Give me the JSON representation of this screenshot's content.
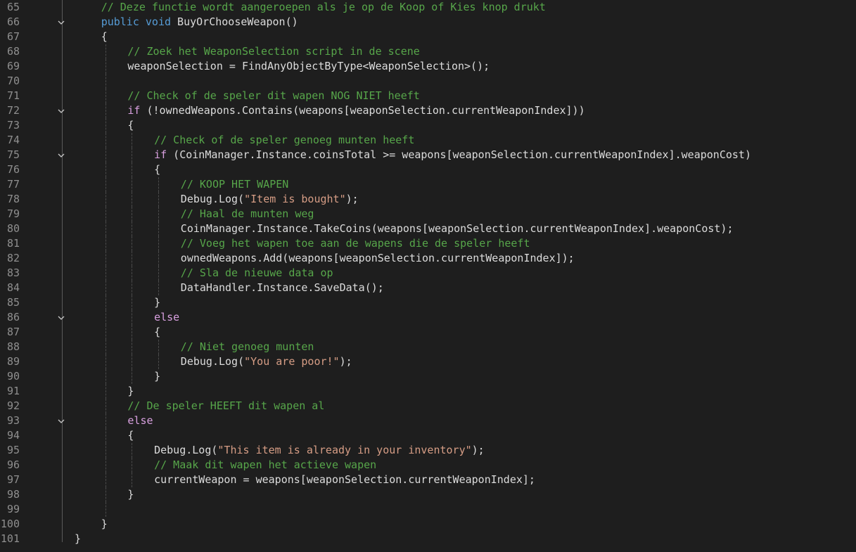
{
  "editor": {
    "colors": {
      "background": "#1e1e1e",
      "line_number": "#8f8f8f",
      "comment": "#57a64a",
      "keyword": "#569cd6",
      "control_keyword": "#d8a0df",
      "string": "#d69d85",
      "plain": "#dcdcdc"
    },
    "fold_icon": "chevron-down-icon",
    "lines": [
      {
        "num": "65",
        "fold": false,
        "indent": 1,
        "tokens": [
          {
            "t": "// Deze functie wordt aangeroepen als je op de Koop of Kies knop drukt",
            "c": "com"
          }
        ]
      },
      {
        "num": "66",
        "fold": true,
        "indent": 1,
        "tokens": [
          {
            "t": "public",
            "c": "kw"
          },
          {
            "t": " ",
            "c": "txt"
          },
          {
            "t": "void",
            "c": "kw"
          },
          {
            "t": " BuyOrChooseWeapon()",
            "c": "txt"
          }
        ]
      },
      {
        "num": "67",
        "fold": false,
        "indent": 1,
        "tokens": [
          {
            "t": "{",
            "c": "txt"
          }
        ]
      },
      {
        "num": "68",
        "fold": false,
        "indent": 2,
        "tokens": [
          {
            "t": "// Zoek het WeaponSelection script in de scene",
            "c": "com"
          }
        ]
      },
      {
        "num": "69",
        "fold": false,
        "indent": 2,
        "tokens": [
          {
            "t": "weaponSelection = FindAnyObjectByType<WeaponSelection>();",
            "c": "txt"
          }
        ]
      },
      {
        "num": "70",
        "fold": false,
        "indent": 2,
        "tokens": []
      },
      {
        "num": "71",
        "fold": false,
        "indent": 2,
        "tokens": [
          {
            "t": "// Check of de speler dit wapen NOG NIET heeft",
            "c": "com"
          }
        ]
      },
      {
        "num": "72",
        "fold": true,
        "indent": 2,
        "tokens": [
          {
            "t": "if",
            "c": "ctl"
          },
          {
            "t": " (!ownedWeapons.Contains(weapons[weaponSelection.currentWeaponIndex]))",
            "c": "txt"
          }
        ]
      },
      {
        "num": "73",
        "fold": false,
        "indent": 2,
        "tokens": [
          {
            "t": "{",
            "c": "txt"
          }
        ]
      },
      {
        "num": "74",
        "fold": false,
        "indent": 3,
        "tokens": [
          {
            "t": "// Check of de speler genoeg munten heeft",
            "c": "com"
          }
        ]
      },
      {
        "num": "75",
        "fold": true,
        "indent": 3,
        "tokens": [
          {
            "t": "if",
            "c": "ctl"
          },
          {
            "t": " (CoinManager.Instance.coinsTotal >= weapons[weaponSelection.currentWeaponIndex].weaponCost)",
            "c": "txt"
          }
        ]
      },
      {
        "num": "76",
        "fold": false,
        "indent": 3,
        "tokens": [
          {
            "t": "{",
            "c": "txt"
          }
        ]
      },
      {
        "num": "77",
        "fold": false,
        "indent": 4,
        "tokens": [
          {
            "t": "// KOOP HET WAPEN",
            "c": "com"
          }
        ]
      },
      {
        "num": "78",
        "fold": false,
        "indent": 4,
        "tokens": [
          {
            "t": "Debug.Log(",
            "c": "txt"
          },
          {
            "t": "\"Item is bought\"",
            "c": "str"
          },
          {
            "t": ");",
            "c": "txt"
          }
        ]
      },
      {
        "num": "79",
        "fold": false,
        "indent": 4,
        "tokens": [
          {
            "t": "// Haal de munten weg",
            "c": "com"
          }
        ]
      },
      {
        "num": "80",
        "fold": false,
        "indent": 4,
        "tokens": [
          {
            "t": "CoinManager.Instance.TakeCoins(weapons[weaponSelection.currentWeaponIndex].weaponCost);",
            "c": "txt"
          }
        ]
      },
      {
        "num": "81",
        "fold": false,
        "indent": 4,
        "tokens": [
          {
            "t": "// Voeg het wapen toe aan de wapens die de speler heeft",
            "c": "com"
          }
        ]
      },
      {
        "num": "82",
        "fold": false,
        "indent": 4,
        "tokens": [
          {
            "t": "ownedWeapons.Add(weapons[weaponSelection.currentWeaponIndex]);",
            "c": "txt"
          }
        ]
      },
      {
        "num": "83",
        "fold": false,
        "indent": 4,
        "tokens": [
          {
            "t": "// Sla de nieuwe data op",
            "c": "com"
          }
        ]
      },
      {
        "num": "84",
        "fold": false,
        "indent": 4,
        "tokens": [
          {
            "t": "DataHandler.Instance.SaveData();",
            "c": "txt"
          }
        ]
      },
      {
        "num": "85",
        "fold": false,
        "indent": 3,
        "tokens": [
          {
            "t": "}",
            "c": "txt"
          }
        ]
      },
      {
        "num": "86",
        "fold": true,
        "indent": 3,
        "tokens": [
          {
            "t": "else",
            "c": "ctl"
          }
        ]
      },
      {
        "num": "87",
        "fold": false,
        "indent": 3,
        "tokens": [
          {
            "t": "{",
            "c": "txt"
          }
        ]
      },
      {
        "num": "88",
        "fold": false,
        "indent": 4,
        "tokens": [
          {
            "t": "// Niet genoeg munten",
            "c": "com"
          }
        ]
      },
      {
        "num": "89",
        "fold": false,
        "indent": 4,
        "tokens": [
          {
            "t": "Debug.Log(",
            "c": "txt"
          },
          {
            "t": "\"You are poor!\"",
            "c": "str"
          },
          {
            "t": ");",
            "c": "txt"
          }
        ]
      },
      {
        "num": "90",
        "fold": false,
        "indent": 3,
        "tokens": [
          {
            "t": "}",
            "c": "txt"
          }
        ]
      },
      {
        "num": "91",
        "fold": false,
        "indent": 2,
        "tokens": [
          {
            "t": "}",
            "c": "txt"
          }
        ]
      },
      {
        "num": "92",
        "fold": false,
        "indent": 2,
        "tokens": [
          {
            "t": "// De speler HEEFT dit wapen al",
            "c": "com"
          }
        ]
      },
      {
        "num": "93",
        "fold": true,
        "indent": 2,
        "tokens": [
          {
            "t": "else",
            "c": "ctl"
          }
        ]
      },
      {
        "num": "94",
        "fold": false,
        "indent": 2,
        "tokens": [
          {
            "t": "{",
            "c": "txt"
          }
        ]
      },
      {
        "num": "95",
        "fold": false,
        "indent": 3,
        "tokens": [
          {
            "t": "Debug.Log(",
            "c": "txt"
          },
          {
            "t": "\"This item is already in your inventory\"",
            "c": "str"
          },
          {
            "t": ");",
            "c": "txt"
          }
        ]
      },
      {
        "num": "96",
        "fold": false,
        "indent": 3,
        "tokens": [
          {
            "t": "// Maak dit wapen het actieve wapen",
            "c": "com"
          }
        ]
      },
      {
        "num": "97",
        "fold": false,
        "indent": 3,
        "tokens": [
          {
            "t": "currentWeapon = weapons[weaponSelection.currentWeaponIndex];",
            "c": "txt"
          }
        ]
      },
      {
        "num": "98",
        "fold": false,
        "indent": 2,
        "tokens": [
          {
            "t": "}",
            "c": "txt"
          }
        ]
      },
      {
        "num": "99",
        "fold": false,
        "indent": 2,
        "tokens": []
      },
      {
        "num": "100",
        "fold": false,
        "indent": 1,
        "tokens": [
          {
            "t": "}",
            "c": "txt"
          }
        ]
      },
      {
        "num": "101",
        "fold": false,
        "indent": 0,
        "tokens": [
          {
            "t": "}",
            "c": "txt"
          }
        ]
      }
    ]
  }
}
